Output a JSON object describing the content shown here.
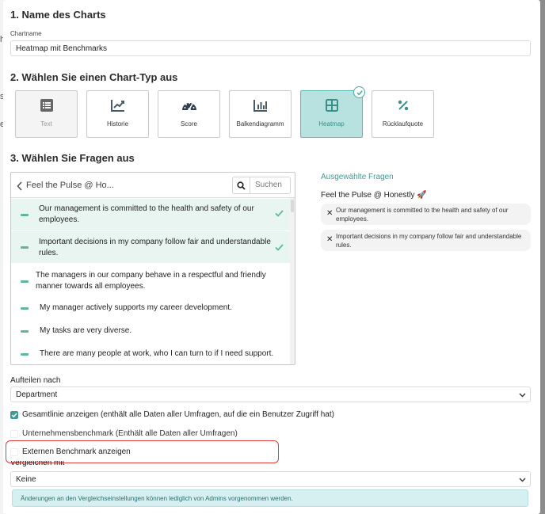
{
  "background": {
    "chars": [
      "h",
      "s",
      "e"
    ]
  },
  "section1": {
    "title": "1. Name des Charts",
    "chartname_label": "Chartname",
    "chartname_value": "Heatmap mit Benchmarks"
  },
  "section2": {
    "title": "2. Wählen Sie einen Chart-Typ aus",
    "types": [
      {
        "label": "Text",
        "icon": "list-icon",
        "state": "disabled"
      },
      {
        "label": "Historie",
        "icon": "trend-chart-icon",
        "state": "normal"
      },
      {
        "label": "Score",
        "icon": "gauge-icon",
        "state": "normal"
      },
      {
        "label": "Balkendiagramm",
        "icon": "bar-chart-icon",
        "state": "normal"
      },
      {
        "label": "Heatmap",
        "icon": "grid-icon",
        "state": "selected"
      },
      {
        "label": "Rücklaufquote",
        "icon": "percent-icon",
        "state": "normal"
      }
    ]
  },
  "section3": {
    "title": "3. Wählen Sie Fragen aus",
    "survey_title": "Feel the Pulse @ Ho...",
    "search_placeholder": "Suchen",
    "questions": [
      {
        "text": "Our management is committed to the health and safety of our employees.",
        "selected": true
      },
      {
        "text": "Important decisions in my company follow fair and understandable rules.",
        "selected": true
      },
      {
        "text": "The managers in our company behave in a respectful and friendly manner towards all employees.",
        "selected": false
      },
      {
        "text": "My manager actively supports my career development.",
        "selected": false
      },
      {
        "text": "My tasks are very diverse.",
        "selected": false
      },
      {
        "text": "There are many people at work, who I can turn to if I need support.",
        "selected": false
      }
    ],
    "selected_header": "Ausgewählte Fragen",
    "selected_group": "Feel the Pulse @ Honestly 🚀",
    "selected_items": [
      "Our management is committed to the health and safety of our employees.",
      "Important decisions in my company follow fair and understandable rules."
    ]
  },
  "split": {
    "label": "Aufteilen nach",
    "value": "Department"
  },
  "options": {
    "total_line": {
      "label": "Gesamtlinie anzeigen (enthält alle Daten aller Umfragen, auf die ein Benutzer Zugriff hat)",
      "checked": true
    },
    "company_benchmark": {
      "label": "Unternehmensbenchmark (Enthält alle Daten aller Umfragen)",
      "checked": false
    },
    "external_benchmark": {
      "label": "Externen Benchmark anzeigen",
      "checked": false
    }
  },
  "compare": {
    "label": "Vergleichen mit",
    "value": "Keine"
  },
  "info_alert": "Änderungen an den Vergleichseinstellungen können lediglich von Admins vorgenommen werden.",
  "colors": {
    "accent": "#3f9b94",
    "selected_bg": "#b7e2df",
    "highlight_border": "#e23c3c"
  }
}
